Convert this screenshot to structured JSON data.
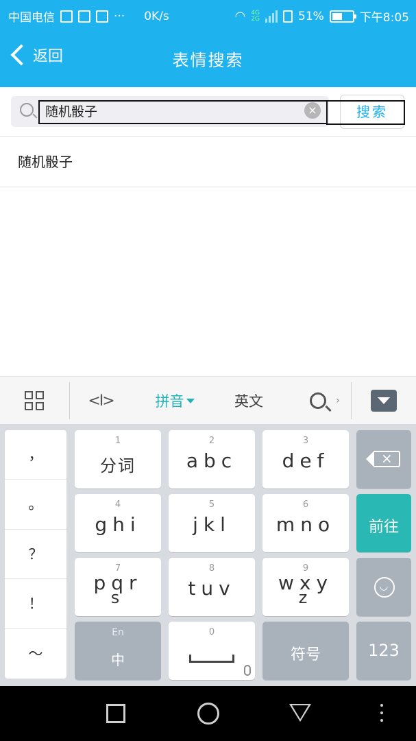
{
  "status": {
    "carrier": "中国电信",
    "net_speed": "0K/s",
    "net_type_top": "4G",
    "net_type_bottom": "2G",
    "battery": "51%",
    "battery_level": 51,
    "time": "下午8:05"
  },
  "header": {
    "back_label": "返回",
    "title": "表情搜索"
  },
  "search": {
    "value": "随机骰子",
    "button_label": "搜索"
  },
  "suggestions": [
    "随机骰子"
  ],
  "keyboard": {
    "toolbar": {
      "pinyin_label": "拼音",
      "english_label": "英文"
    },
    "punctuation": [
      "，",
      "。",
      "？",
      "！",
      "～"
    ],
    "keys": {
      "k1": {
        "num": "1",
        "label": "分词"
      },
      "k2": {
        "num": "2",
        "label": "abc"
      },
      "k3": {
        "num": "3",
        "label": "def"
      },
      "k4": {
        "num": "4",
        "label": "ghi"
      },
      "k5": {
        "num": "5",
        "label": "jkl"
      },
      "k6": {
        "num": "6",
        "label": "mno"
      },
      "k7": {
        "num": "7",
        "label": "pqr",
        "sub": "s"
      },
      "k8": {
        "num": "8",
        "label": "tuv"
      },
      "k9": {
        "num": "9",
        "label": "wxy",
        "sub": "z"
      },
      "k0": {
        "num": "0"
      }
    },
    "next_label": "前往",
    "lang_top": "En",
    "lang_bottom": "中",
    "symbol_label": "符号",
    "numeric_label": "123"
  },
  "colors": {
    "accent": "#1eb3ee",
    "keyboard_teal": "#2ab8b5"
  }
}
